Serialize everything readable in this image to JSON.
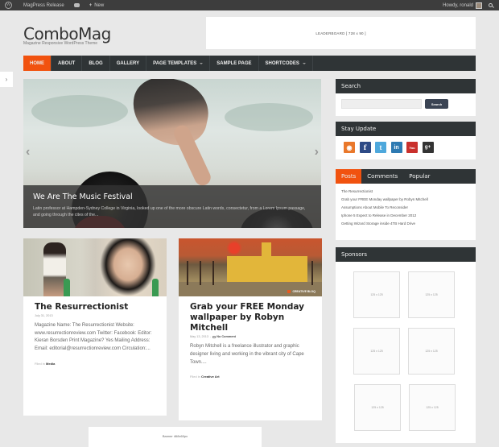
{
  "admin_bar": {
    "site_name": "MagPress Release",
    "new_label": "New",
    "greeting": "Howdy, ronald"
  },
  "header": {
    "logo": "ComboMag",
    "tagline": "Magazine Responsive WordPress Theme",
    "leaderboard": "LEADERBOARD [ 728 x 90 ]"
  },
  "nav": {
    "items": [
      {
        "label": "HOME",
        "active": true
      },
      {
        "label": "ABOUT"
      },
      {
        "label": "BLOG"
      },
      {
        "label": "GALLERY"
      },
      {
        "label": "PAGE TEMPLATES",
        "dropdown": true
      },
      {
        "label": "SAMPLE PAGE"
      },
      {
        "label": "SHORTCODES",
        "dropdown": true
      }
    ]
  },
  "side_toggle": "›",
  "slider": {
    "title": "We Are The Music Festival",
    "excerpt": "Latin professor at Hampden-Sydney College in Virginia, looked up one of the more obscure Latin words, consectetur, from a Lorem Ipsum passage, and going through the cites of the...",
    "prev": "‹",
    "next": "›"
  },
  "posts": [
    {
      "title": "The Resurrectionist",
      "date": "July 31, 2013",
      "excerpt": "Magazine Name: The Resurrectionist Website: www.resurrectionreview.com Twitter: Facebook: Editor: Kieran Borsden Print Magazine? Yes Mailing Address: Email: editorial@resurrectionreview.com Circulation:...",
      "filed_prefix": "Filed in",
      "category": "Media"
    },
    {
      "title": "Grab your FREE Monday wallpaper by Robyn Mitchell",
      "date": "May 13, 2013",
      "comments": "No Comment",
      "excerpt": "Robyn Mitchell is a freelance illustrator and graphic designer living and working in the vibrant city of Cape Town....",
      "filed_prefix": "Filed in",
      "category": "Creative Art",
      "thumb_badge": "CREATIVE BLOQ"
    }
  ],
  "banner": "Banner 468x60px",
  "sidebar": {
    "search": {
      "title": "Search",
      "placeholder": "",
      "button": "Search"
    },
    "stay": {
      "title": "Stay Update",
      "icons": [
        {
          "name": "rss-icon",
          "glyph": "◉"
        },
        {
          "name": "facebook-icon",
          "glyph": "f"
        },
        {
          "name": "twitter-icon",
          "glyph": "t"
        },
        {
          "name": "linkedin-icon",
          "glyph": "in"
        },
        {
          "name": "youtube-icon",
          "glyph": "You"
        },
        {
          "name": "googleplus-icon",
          "glyph": "g+"
        }
      ]
    },
    "tabs": {
      "labels": [
        "Posts",
        "Comments",
        "Popular"
      ],
      "active": 0,
      "items": [
        "The Resurrectionist",
        "Grab your FREE Monday wallpaper by Robyn Mitchell",
        "Assumptions About Mobile To Reconsider",
        "Iphone 5 Expect to Release in December 2012",
        "Getting Wizard Storage inside 4TB Hard Drive"
      ]
    },
    "sponsors": {
      "title": "Sponsors",
      "ads": [
        "125 x 125",
        "125 x 125",
        "125 x 125",
        "125 x 125",
        "125 x 125",
        "125 x 125"
      ]
    }
  }
}
